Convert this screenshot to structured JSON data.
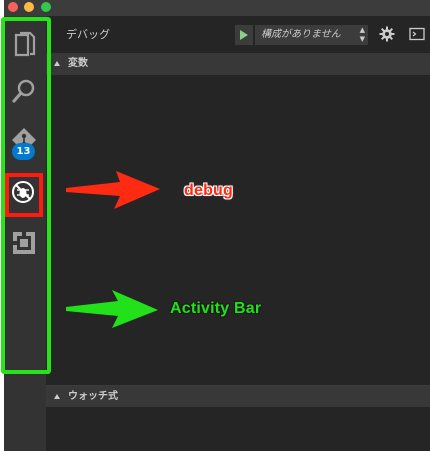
{
  "sidebar": {
    "title": "デバッグ",
    "configuration": "構成がありません",
    "config_arrows": [
      "▲",
      "▼"
    ],
    "sections": {
      "variables": "変数",
      "watch": "ウォッチ式"
    }
  },
  "activity_bar": {
    "items": [
      {
        "icon": "files-icon"
      },
      {
        "icon": "search-icon"
      },
      {
        "icon": "git-icon",
        "badge": "13"
      },
      {
        "icon": "debug-icon",
        "active": true
      },
      {
        "icon": "extensions-icon"
      }
    ]
  },
  "annotations": {
    "debug_label": "debug",
    "activity_label": "Activity Bar",
    "colors": {
      "debug": "#ff2a12",
      "activity": "#22e01a"
    }
  },
  "colors": {
    "window_bg": "#252526",
    "activity_bar_bg": "#333333",
    "section_header_bg": "#383838",
    "play": "#89d185",
    "badge": "#007acc"
  }
}
